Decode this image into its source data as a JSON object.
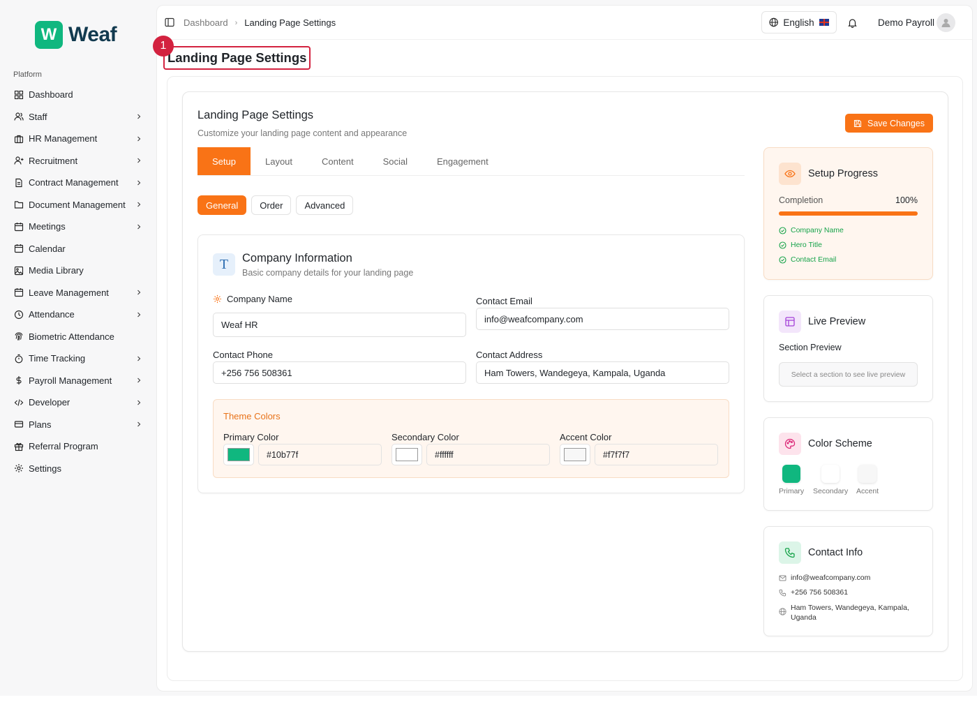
{
  "brand": {
    "logo_letter": "W",
    "name": "Weaf",
    "color": "#10b77f"
  },
  "sidebar": {
    "section": "Platform",
    "items": [
      {
        "label": "Dashboard",
        "icon": "grid-icon",
        "chevron": false
      },
      {
        "label": "Staff",
        "icon": "users-icon",
        "chevron": true
      },
      {
        "label": "HR Management",
        "icon": "briefcase-icon",
        "chevron": true
      },
      {
        "label": "Recruitment",
        "icon": "user-plus-icon",
        "chevron": true
      },
      {
        "label": "Contract Management",
        "icon": "file-icon",
        "chevron": true
      },
      {
        "label": "Document Management",
        "icon": "folder-icon",
        "chevron": true
      },
      {
        "label": "Meetings",
        "icon": "calendar-icon",
        "chevron": true
      },
      {
        "label": "Calendar",
        "icon": "calendar-icon",
        "chevron": false
      },
      {
        "label": "Media Library",
        "icon": "image-icon",
        "chevron": false
      },
      {
        "label": "Leave Management",
        "icon": "calendar-icon",
        "chevron": true
      },
      {
        "label": "Attendance",
        "icon": "clock-icon",
        "chevron": true
      },
      {
        "label": "Biometric Attendance",
        "icon": "fingerprint-icon",
        "chevron": false
      },
      {
        "label": "Time Tracking",
        "icon": "timer-icon",
        "chevron": true
      },
      {
        "label": "Payroll Management",
        "icon": "dollar-icon",
        "chevron": true
      },
      {
        "label": "Developer",
        "icon": "code-icon",
        "chevron": true
      },
      {
        "label": "Plans",
        "icon": "credit-card-icon",
        "chevron": true
      },
      {
        "label": "Referral Program",
        "icon": "gift-icon",
        "chevron": false
      },
      {
        "label": "Settings",
        "icon": "gear-icon",
        "chevron": false
      }
    ]
  },
  "topbar": {
    "breadcrumb": [
      "Dashboard",
      "Landing Page Settings"
    ],
    "language": "English",
    "user_name": "Demo Payroll"
  },
  "annotation": {
    "number": "1"
  },
  "page": {
    "title": "Landing Page Settings"
  },
  "settings": {
    "title": "Landing Page Settings",
    "subtitle": "Customize your landing page content and appearance",
    "save_label": "Save Changes",
    "accent": "#f97316",
    "tabs": [
      "Setup",
      "Layout",
      "Content",
      "Social",
      "Engagement"
    ],
    "active_tab": "Setup",
    "subtabs": [
      "General",
      "Order",
      "Advanced"
    ],
    "active_subtab": "General"
  },
  "company": {
    "title": "Company Information",
    "subtitle": "Basic company details for your landing page",
    "fields": {
      "company_name": {
        "label": "Company Name",
        "value": "Weaf HR"
      },
      "contact_email": {
        "label": "Contact Email",
        "value": "info@weafcompany.com"
      },
      "contact_phone": {
        "label": "Contact Phone",
        "value": "+256 756 508361"
      },
      "contact_address": {
        "label": "Contact Address",
        "value": "Ham Towers, Wandegeya, Kampala, Uganda"
      }
    },
    "theme": {
      "title": "Theme Colors",
      "primary": {
        "label": "Primary Color",
        "value": "#10b77f"
      },
      "secondary": {
        "label": "Secondary Color",
        "value": "#ffffff"
      },
      "accent": {
        "label": "Accent Color",
        "value": "#f7f7f7"
      }
    }
  },
  "progress": {
    "title": "Setup Progress",
    "label": "Completion",
    "value_text": "100%",
    "value": 1.0,
    "checks": [
      "Company Name",
      "Hero Title",
      "Contact Email"
    ]
  },
  "preview": {
    "title": "Live Preview",
    "section_label": "Section Preview",
    "placeholder": "Select a section to see live preview"
  },
  "scheme": {
    "title": "Color Scheme",
    "items": [
      {
        "label": "Primary",
        "color": "#10b77f"
      },
      {
        "label": "Secondary",
        "color": "#ffffff"
      },
      {
        "label": "Accent",
        "color": "#f7f7f7"
      }
    ]
  },
  "contact_info": {
    "title": "Contact Info",
    "email": "info@weafcompany.com",
    "phone": "+256 756 508361",
    "address": "Ham Towers, Wandegeya, Kampala, Uganda"
  }
}
